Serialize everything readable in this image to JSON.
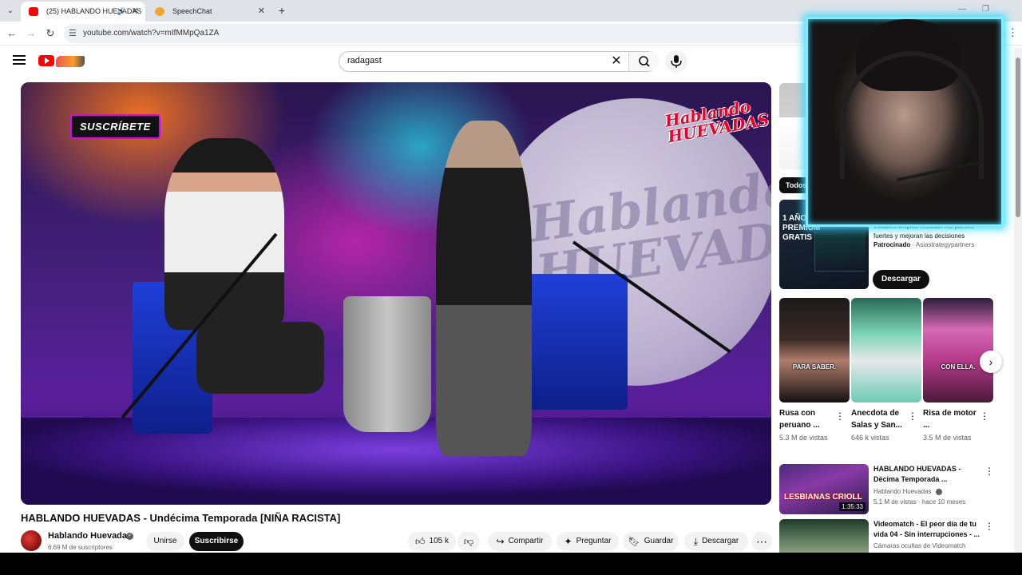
{
  "browser": {
    "tabs": [
      {
        "title": "(25) HABLANDO HUEVADAS",
        "favicon_color": "#ff0000",
        "active": true
      },
      {
        "title": "SpeechChat",
        "favicon_color": "#f4a52c",
        "active": false
      }
    ],
    "url": "youtube.com/watch?v=mIfMMpQa1ZA"
  },
  "header": {
    "search_value": "radagast"
  },
  "video": {
    "overlay_badge": "SUSCRÍBETE",
    "show_logo": "Hablando HUEVADAS",
    "moon_text": "Hablando HUEVADAS",
    "title": "HABLANDO HUEVADAS - Undécima Temporada [NIÑA RACISTA]",
    "channel": {
      "name": "Hablando Huevadas",
      "subscribers": "6.69 M de suscriptores"
    },
    "actions": {
      "join": "Unirse",
      "subscribe": "Suscribirse",
      "likes": "105 k",
      "share": "Compartir",
      "ask": "Preguntar",
      "save": "Guardar",
      "download": "Descargar"
    }
  },
  "rail": {
    "chip_all": "Todos",
    "ad": {
      "thumb_text": "1 AÑO PREMIUM GRATIS",
      "description": "visuales limpios resaltan los puntos fuertes y mejoran las decisiones",
      "sponsored_label": "Patrocinado",
      "advertiser": "Asiastrategypartners",
      "cta": "Descargar"
    },
    "shorts": [
      {
        "title": "Rusa con peruano ...",
        "views": "5.3 M de vistas",
        "caption": "PARA SABER."
      },
      {
        "title": "Anecdota de Salas y San...",
        "views": "646 k vistas",
        "caption": ""
      },
      {
        "title": "Risa de motor ...",
        "views": "3.5 M de vistas",
        "caption": "CON ELLA."
      }
    ],
    "recommendations": [
      {
        "title": "HABLANDO HUEVADAS - Décima Temporada ...",
        "channel": "Hablando Huevadas",
        "meta": "5.1 M de vistas · hace 10 meses",
        "duration": "1:35:33",
        "thumb_text": "LESBIANAS CRIOLL"
      },
      {
        "title": "Videomatch - El peor día de tu vida 04 - Sin interrupciones - ...",
        "channel": "Cámaras ocultas de Videomatch",
        "meta": "",
        "duration": "",
        "thumb_text": ""
      }
    ]
  },
  "colors": {
    "brand_red": "#ff0000",
    "webcam_glow": "#3fd8ff",
    "badge_purple": "#d900ff"
  }
}
